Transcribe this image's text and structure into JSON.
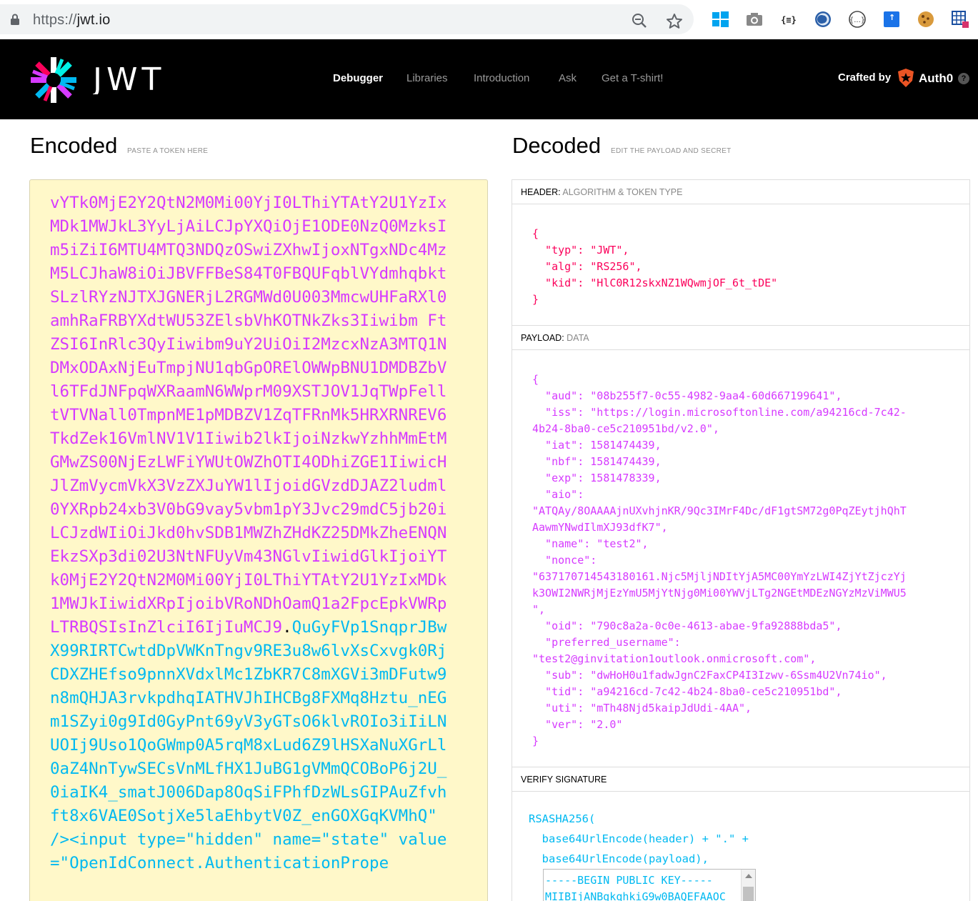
{
  "browser": {
    "url_scheme": "https://",
    "url_host": "jwt.io"
  },
  "nav": {
    "brand": "JWT",
    "links": [
      "Debugger",
      "Libraries",
      "Introduction",
      "Ask",
      "Get a T-shirt!"
    ],
    "active_link": "Debugger",
    "crafted_by": "Crafted by",
    "partner": "Auth0",
    "help": "?"
  },
  "encoded": {
    "title": "Encoded",
    "subtitle": "PASTE A TOKEN HERE",
    "payload_part": "vYTk0MjE2Y2QtN2M0Mi00YjI0LThiYTAtY2U1YzIxMDk1MWJkL3YyLjAiLCJpYXQiOjE1ODE0NzQ0MzksIm5iZiI6MTU4MTQ3NDQzOSwiZXhwIjoxNTgxNDc4MzM5LCJhaW8iOiJBVFFBeS84T0FBQUFqblVYdmhqbktSLzlRYzNJTXJGNERjL2RGMWd0U003MmcwUHFaRXl0amhRaFRBYXdtWU53ZElsbVhKOTNkZks3Iiwibm FtZSI6InRlc3QyIiwibm9uY2UiOiI2MzcxNzA3MTQ1NDMxODAxNjEuTmpjNU1qbGpORElOWWpBNU1DMDBZbVl6TFdJNFpqWXRaamN6WWprM09XSTJOV1JqTWpFelltVTVNall0TmpnME1pMDBZV1ZqTFRnMk5HRXRNREV6TkdZek16VmlNV1V1Iiwib2lkIjoiNzkwYzhhMmEtMGMwZS00NjEzLWFiYWUtOWZhOTI4ODhiZGE1IiwicHJlZmVycmVkX3VzZXJuYW1lIjoidGVzdDJAZ2ludml0YXRpb24xb3V0bG9vay5vbm1pY3Jvc29mdC5jb20iLCJzdWIiOiJkd0hvSDB1MWZhZHdKZ25DMkZheENQNEkzSXp3di02U3NtNFUyVm43NGlvIiwidGlkIjoiYTk0MjE2Y2QtN2M0Mi00YjI0LThiYTAtY2U1YzIxMDk1MWJkIiwidXRpIjoibVRoNDhOamQ1a2FpcEpkVWRpLTRBQSIsInZlciI6IjIuMCJ9",
    "dot": ".",
    "signature_part": "QuGyFVp1SnqprJBwX99RIRTCwtdDpVWKnTngv9RE3u8w6lvXsCxvgk0RjCDXZHEfso9pnnXVdxlMc1ZbKR7C8mXGVi3mDFutw9n8mQHJA3rvkpdhqIATHVJhIHCBg8FXMq8Hztu_nEGm1SZyi0g9Id0GyPnt69yV3yGTsO6klvROIo3iIiLNUOIj9Uso1QoGWmp0A5rqM8xLud6Z9lHSXaNuXGrLl0aZ4NnTywSECsVnMLfHX1JuBG1gVMmQCOBoP6j2U_0iaIK4_smatJ006Dap8OqSiFPhfDzWLsGIPAuZfvhft8x6VAE0SotjXe5laEhbytV0Z_enGOXGqKVMhQ\" /><input type=\"hidden\" name=\"state\" value=\"OpenIdConnect.AuthenticationPrope"
  },
  "decoded": {
    "title": "Decoded",
    "subtitle": "EDIT THE PAYLOAD AND SECRET",
    "header_label": "HEADER:",
    "header_sub": "ALGORITHM & TOKEN TYPE",
    "header_json": "{\n  \"typ\": \"JWT\",\n  \"alg\": \"RS256\",\n  \"kid\": \"HlC0R12skxNZ1WQwmjOF_6t_tDE\"\n}",
    "payload_label": "PAYLOAD:",
    "payload_sub": "DATA",
    "payload_json": "{\n  \"aud\": \"08b255f7-0c55-4982-9aa4-60d667199641\",\n  \"iss\": \"https://login.microsoftonline.com/a94216cd-7c42-\n4b24-8ba0-ce5c210951bd/v2.0\",\n  \"iat\": 1581474439,\n  \"nbf\": 1581474439,\n  \"exp\": 1581478339,\n  \"aio\":\n\"ATQAy/8OAAAAjnUXvhjnKR/9Qc3IMrF4Dc/dF1gtSM72g0PqZEytjhQhT\nAawmYNwdIlmXJ93dfK7\",\n  \"name\": \"test2\",\n  \"nonce\":\n\"637170714543180161.Njc5MjljNDItYjA5MC00YmYzLWI4ZjYtZjczYj\nk3OWI2NWRjMjEzYmU5MjYtNjg0Mi00YWVjLTg2NGEtMDEzNGYzMzViMWU5\n\",\n  \"oid\": \"790c8a2a-0c0e-4613-abae-9fa92888bda5\",\n  \"preferred_username\":\n\"test2@ginvitation1outlook.onmicrosoft.com\",\n  \"sub\": \"dwHoH0u1fadwJgnC2FaxCP4I3Izwv-6Ssm4U2Vn74io\",\n  \"tid\": \"a94216cd-7c42-4b24-8ba0-ce5c210951bd\",\n  \"uti\": \"mTh48Njd5kaipJdUdi-4AA\",\n  \"ver\": \"2.0\"\n}",
    "verify_label": "VERIFY SIGNATURE",
    "verify_code": "RSASHA256(\n  base64UrlEncode(header) + \".\" +\n  base64UrlEncode(payload),",
    "public_key": "-----BEGIN PUBLIC KEY-----\nMIIBIjANBgkqhkiG9w0BAQEFAAOC"
  },
  "colors": {
    "nav_bg": "#000000",
    "encoded_bg": "#fff8c9",
    "payload_color": "#d63aff",
    "signature_color": "#00b9f1",
    "header_color": "#fb015b"
  }
}
